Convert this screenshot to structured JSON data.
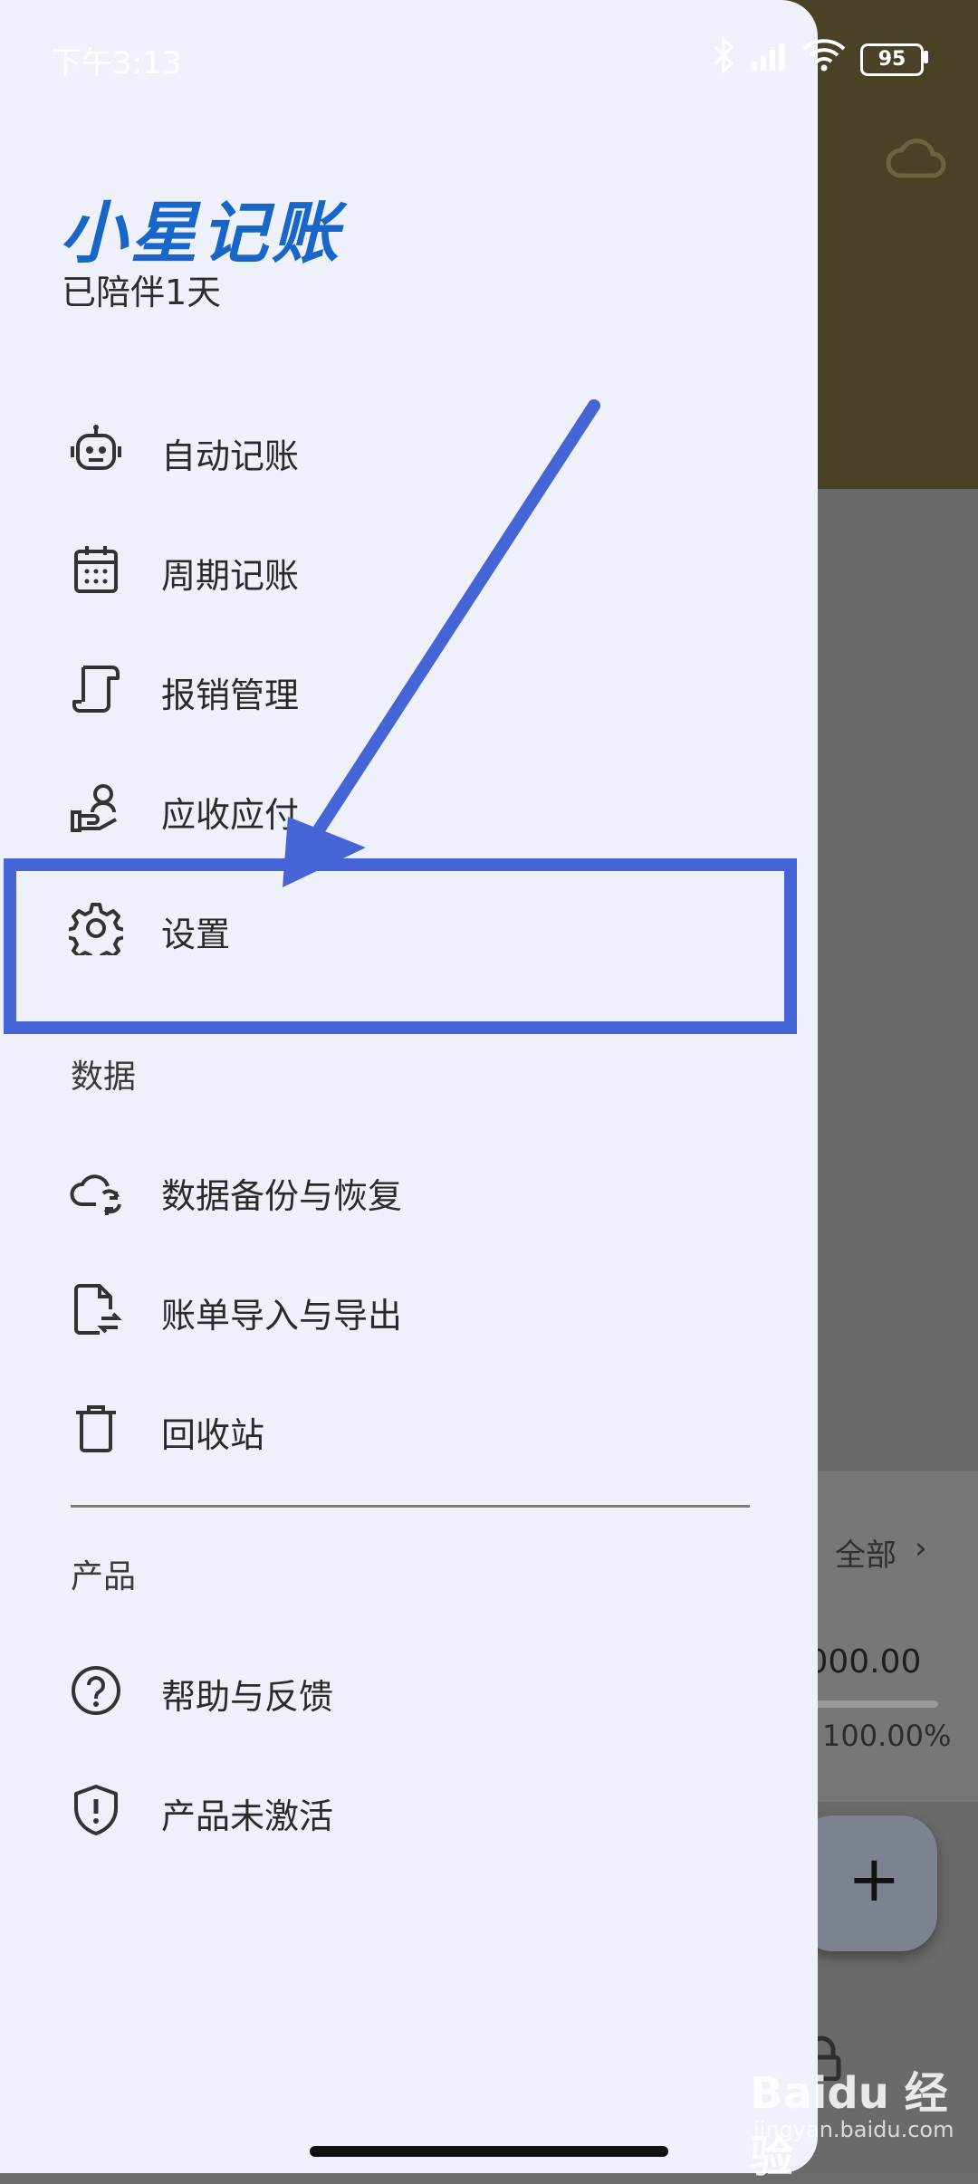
{
  "status_bar": {
    "time": "下午3:13",
    "battery": "95"
  },
  "drawer": {
    "app_name": "小星记账",
    "companion_text": "已陪伴1天",
    "menu": [
      {
        "label": "自动记账",
        "icon": "robot-icon"
      },
      {
        "label": "周期记账",
        "icon": "calendar-icon"
      },
      {
        "label": "报销管理",
        "icon": "receipt-icon"
      },
      {
        "label": "应收应付",
        "icon": "hand-user-icon"
      },
      {
        "label": "设置",
        "icon": "gear-icon"
      }
    ],
    "data_section": {
      "title": "数据",
      "items": [
        {
          "label": "数据备份与恢复",
          "icon": "cloud-sync-icon"
        },
        {
          "label": "账单导入与导出",
          "icon": "file-transfer-icon"
        },
        {
          "label": "回收站",
          "icon": "trash-icon"
        }
      ]
    },
    "product_section": {
      "title": "产品",
      "items": [
        {
          "label": "帮助与反馈",
          "icon": "help-icon"
        },
        {
          "label": "产品未激活",
          "icon": "shield-alert-icon"
        }
      ]
    }
  },
  "background_app": {
    "all_label": "全部",
    "amount": ",000.00",
    "percent": "100.00%"
  },
  "annotation": {
    "color": "#4565d6"
  },
  "watermark": {
    "text": "Baidu 经验",
    "sub": "jingyan.baidu.com"
  },
  "colors": {
    "brand": "#1966c9",
    "drawer_bg": "#eef1fa",
    "text": "#2a2a2a"
  }
}
